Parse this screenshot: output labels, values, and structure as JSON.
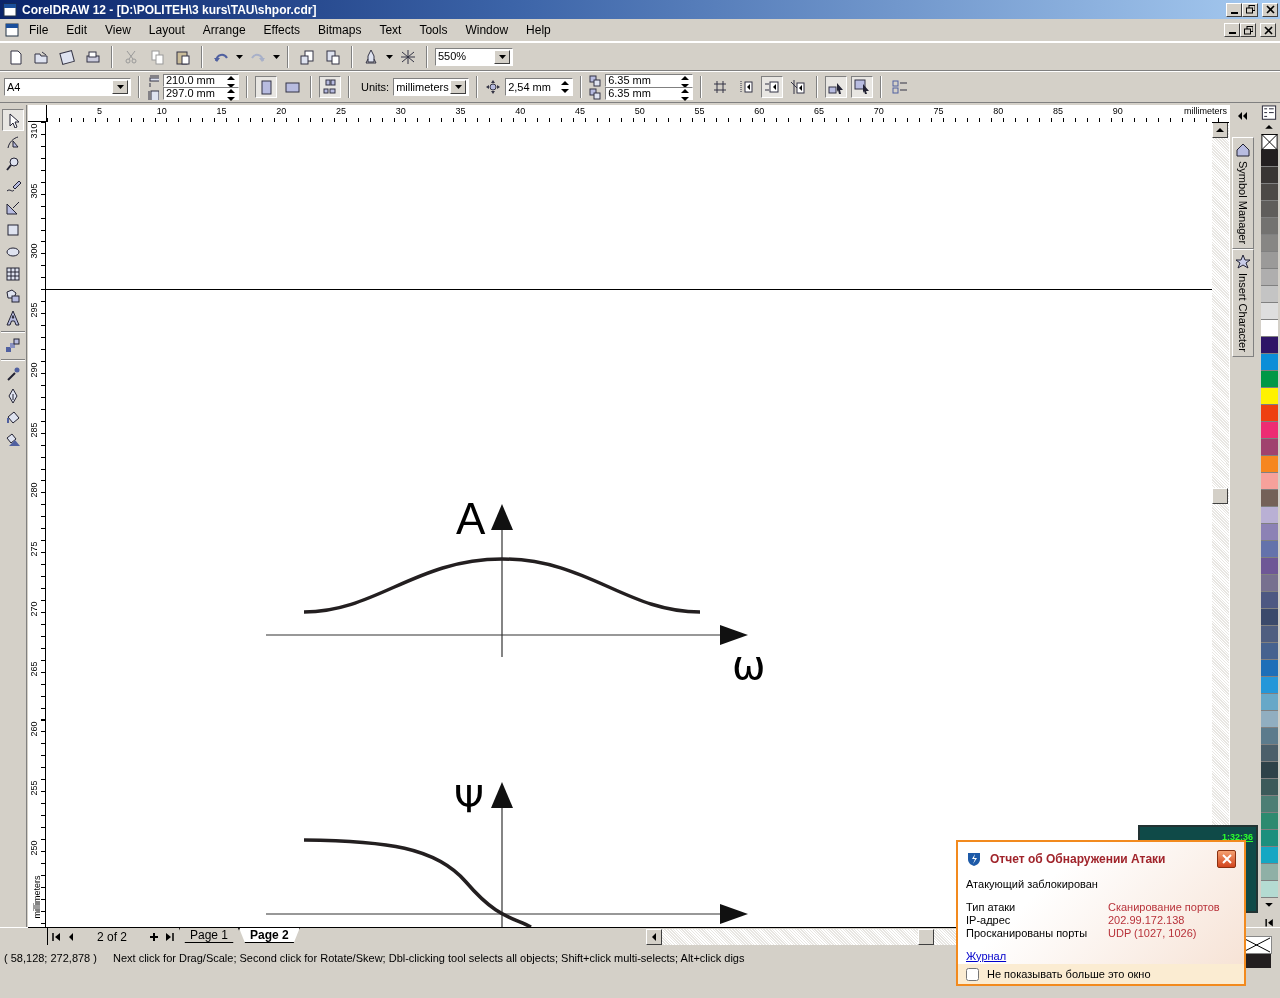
{
  "window": {
    "title": "CorelDRAW 12 - [D:\\POLITEH\\3 kurs\\TAU\\shpor.cdr]"
  },
  "menu": [
    "File",
    "Edit",
    "View",
    "Layout",
    "Arrange",
    "Effects",
    "Bitmaps",
    "Text",
    "Tools",
    "Window",
    "Help"
  ],
  "standard_toolbar": {
    "zoom": "550%"
  },
  "property_bar": {
    "paper": "A4",
    "width": "210.0 mm",
    "height": "297.0 mm",
    "orientation_buttons": [
      {
        "selected": true
      },
      {
        "selected": false
      }
    ],
    "units_label": "Units:",
    "units": "millimeters",
    "nudge": "2,54 mm",
    "duplicate_x": "6.35 mm",
    "duplicate_y": "6.35 mm",
    "toggles": [
      {
        "pressed": true
      },
      {
        "pressed": false
      },
      {
        "pressed": false
      },
      {
        "pressed": true
      },
      {
        "pressed": false
      },
      {
        "pressed": true
      },
      {
        "pressed": true
      }
    ]
  },
  "rulers": {
    "horizontal": [
      "5",
      "10",
      "15",
      "20",
      "25",
      "30",
      "35",
      "40",
      "45",
      "50",
      "55",
      "60",
      "65",
      "70",
      "75",
      "80",
      "85",
      "90"
    ],
    "horizontal_unit": "millimeters",
    "vertical": [
      "310",
      "305",
      "300",
      "295",
      "290",
      "285",
      "280",
      "275",
      "270",
      "265",
      "260",
      "255",
      "250"
    ],
    "vertical_unit": "millimeters"
  },
  "toolbox": [
    {
      "selected": true
    },
    {
      "selected": false
    },
    {
      "selected": false
    },
    {
      "selected": false
    },
    {
      "selected": false
    },
    {
      "selected": false
    },
    {
      "selected": false
    },
    {
      "selected": false
    },
    {
      "selected": false
    },
    {
      "selected": false
    },
    {
      "selected": false
    },
    {
      "selected": false
    },
    {
      "selected": false
    },
    {
      "selected": false
    },
    {
      "selected": false
    }
  ],
  "canvas": {
    "graph_1": {
      "y_label": "A",
      "x_label": "ω"
    },
    "graph_2": {
      "y_label": "Ψ"
    }
  },
  "page_navigator": {
    "position": "2 of 2",
    "tabs": [
      {
        "label": "Page 1",
        "selected": false
      },
      {
        "label": "Page 2",
        "selected": true
      }
    ]
  },
  "dockers": [
    "Symbol Manager",
    "Insert Character"
  ],
  "palette": [
    {
      "color": "#231f20"
    },
    {
      "color": "#393634"
    },
    {
      "color": "#4d4a47"
    },
    {
      "color": "#5f5d5b"
    },
    {
      "color": "#737270"
    },
    {
      "color": "#878684"
    },
    {
      "color": "#9b9a99"
    },
    {
      "color": "#afaeae"
    },
    {
      "color": "#c4c4c4"
    },
    {
      "color": "#dedede"
    },
    {
      "color": "#ffffff"
    },
    {
      "color": "#2e1567"
    },
    {
      "color": "#0a8ed8"
    },
    {
      "color": "#009846"
    },
    {
      "color": "#fff200"
    },
    {
      "color": "#ee4010"
    },
    {
      "color": "#ed2c73"
    },
    {
      "color": "#a0426e"
    },
    {
      "color": "#f6861f"
    },
    {
      "color": "#f6a19b"
    },
    {
      "color": "#746158"
    },
    {
      "color": "#b9b0d4"
    },
    {
      "color": "#8c82b5"
    },
    {
      "color": "#6472ab"
    },
    {
      "color": "#6e5796"
    },
    {
      "color": "#77708f"
    },
    {
      "color": "#4d5882"
    },
    {
      "color": "#3b4a6b"
    },
    {
      "color": "#4f5e80"
    },
    {
      "color": "#46628f"
    },
    {
      "color": "#1d6fb8"
    },
    {
      "color": "#2497d9"
    },
    {
      "color": "#67a8c8"
    },
    {
      "color": "#91aec0"
    },
    {
      "color": "#5c7b8c"
    },
    {
      "color": "#4b5f6a"
    },
    {
      "color": "#2e4249"
    },
    {
      "color": "#3c5a5a"
    },
    {
      "color": "#4c7e74"
    },
    {
      "color": "#2d8a6f"
    },
    {
      "color": "#1c8f7d"
    },
    {
      "color": "#15a7c3"
    },
    {
      "color": "#8fb0a6"
    },
    {
      "color": "#b4dbd2"
    }
  ],
  "status_bar": {
    "coordinates": "( 58,128; 272,878 )",
    "hint": "Next click for Drag/Scale; Second click for Rotate/Skew; Dbl-clicking tool selects all objects; Shift+click multi-selects; Alt+click digs"
  },
  "clock_widget": {
    "time": "1:32:36"
  },
  "attack_popup": {
    "title": "Отчет об Обнаружении Атаки",
    "message": "Атакующий заблокирован",
    "details": [
      {
        "label": "Тип атаки",
        "value": "Сканирование портов"
      },
      {
        "label": "IP-адрес",
        "value": "202.99.172.138"
      },
      {
        "label": "Просканированы порты",
        "value": "UDP (1027, 1026)"
      }
    ],
    "link": "Журнал",
    "checkbox": {
      "label": "Не показывать больше это окно",
      "checked": false
    }
  }
}
